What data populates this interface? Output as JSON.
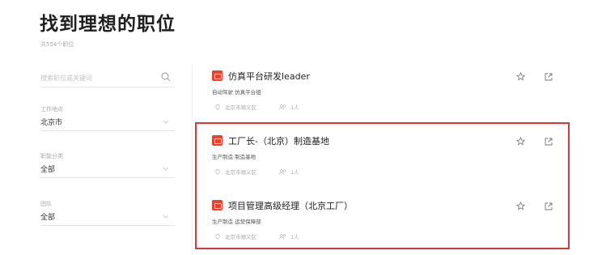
{
  "header": {
    "title": "找到理想的职位",
    "job_count": "共554个职位"
  },
  "search": {
    "placeholder": "搜索职位或关键词",
    "icon": "search-icon"
  },
  "filters": [
    {
      "label": "工作地点",
      "value": "北京市"
    },
    {
      "label": "职能分类",
      "value": "全部"
    },
    {
      "label": "团队",
      "value": "全部"
    }
  ],
  "jobs": [
    {
      "title": "仿真平台研发leader",
      "tags": "自动驾驶 仿真平台组",
      "location": "北京市顺义区",
      "headcount": "1人"
    },
    {
      "title": "工厂长-（北京）制造基地",
      "tags": "生产制造 制造基地",
      "location": "北京市顺义区",
      "headcount": "1人"
    },
    {
      "title": "项目管理高级经理（北京工厂）",
      "tags": "生产制造 运营保障部",
      "location": "北京市顺义区",
      "headcount": "1人"
    }
  ],
  "colors": {
    "badge": "#e8432e",
    "highlight_border": "#d9363e"
  }
}
